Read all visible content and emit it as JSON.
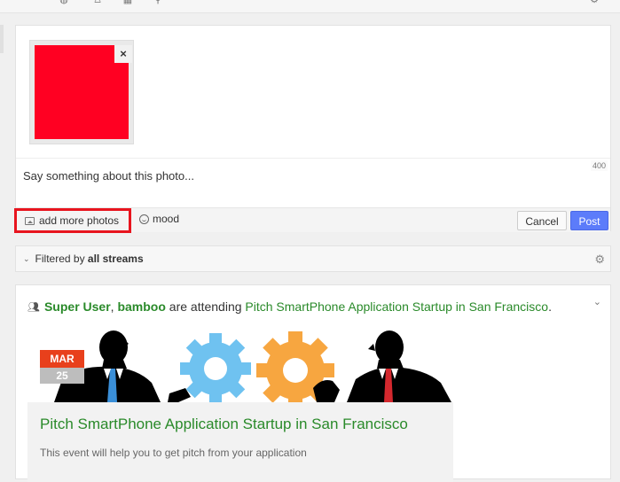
{
  "toolbar_top": {
    "icons": [
      "globe-icon",
      "person-icon",
      "calendar-icon",
      "search-icon",
      "settings-icon"
    ]
  },
  "composer": {
    "photo_color": "#ff0022",
    "remove_label": "×",
    "char_count": "400",
    "text": "Say something about this photo...",
    "add_photos_label": "add more photos",
    "mood_label": "mood",
    "cancel_label": "Cancel",
    "post_label": "Post",
    "accent_color": "#5c7cfa",
    "highlight_color": "#e8141e"
  },
  "filter": {
    "prefix": "Filtered by",
    "value": "all streams"
  },
  "activity": {
    "user1": "Super User",
    "separator": ",",
    "user2": "bamboo",
    "verb": "are attending",
    "event_link": "Pitch SmartPhone Application Startup in San Francisco",
    "period": ".",
    "date_month": "MAR",
    "date_day": "25",
    "event_title": "Pitch SmartPhone Application Startup in San Francisco",
    "event_desc": "This event will help you to get pitch from your application",
    "link_color": "#2a8a2a"
  }
}
